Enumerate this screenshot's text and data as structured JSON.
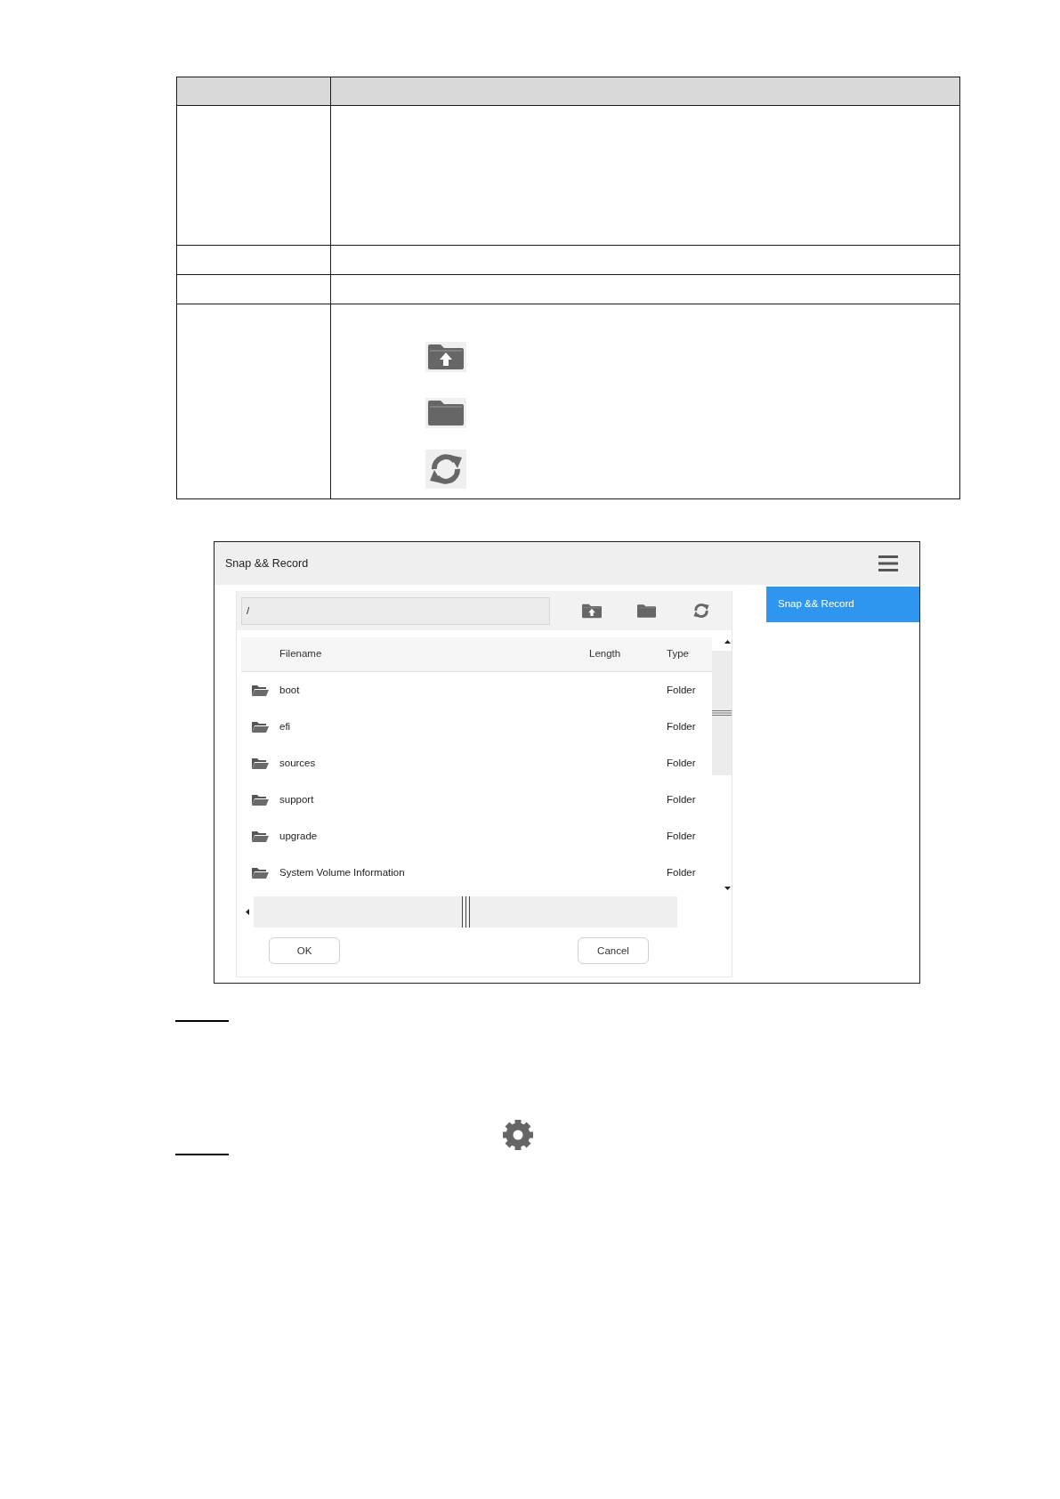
{
  "doc_table": {
    "rows": [
      {
        "kind": "header"
      },
      {
        "kind": "tall"
      },
      {
        "kind": "short"
      },
      {
        "kind": "short"
      },
      {
        "kind": "icons"
      }
    ]
  },
  "dialog": {
    "title": "Snap && Record",
    "sidebar": {
      "items": [
        {
          "label": "Snap && Record",
          "selected": true
        }
      ]
    },
    "path_field": {
      "value": "/"
    },
    "file_table": {
      "columns": [
        "Filename",
        "Length",
        "Type"
      ],
      "rows": [
        {
          "filename": "boot",
          "type": "Folder"
        },
        {
          "filename": "efi",
          "type": "Folder"
        },
        {
          "filename": "sources",
          "type": "Folder"
        },
        {
          "filename": "support",
          "type": "Folder"
        },
        {
          "filename": "upgrade",
          "type": "Folder"
        },
        {
          "filename": "System Volume Information",
          "type": "Folder"
        }
      ]
    },
    "buttons": [
      "OK",
      "Cancel"
    ]
  }
}
